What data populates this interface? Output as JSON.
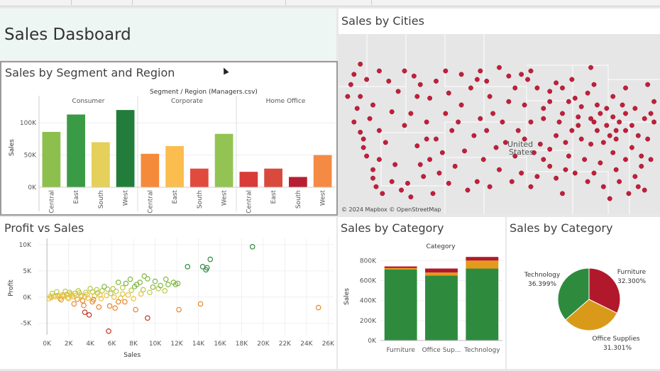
{
  "dashboard": {
    "title": "Sales Dasboard"
  },
  "segment_panel": {
    "title": "Sales by Segment and Region",
    "header": "Segment / Region (Managers.csv)"
  },
  "map_panel": {
    "title": "Sales by Cities",
    "credit": "© 2024 Mapbox © OpenStreetMap",
    "label_united": "United",
    "label_states": "States"
  },
  "scatter_panel": {
    "title": "Profit vs Sales"
  },
  "category_panel": {
    "title": "Sales  by Category",
    "legend_title": "Category"
  },
  "pie_panel": {
    "title": "Sales by Category"
  },
  "colors": {
    "red": "#b2182b",
    "orange": "#f08a3e",
    "yellow": "#e6d05a",
    "green": "#2e8b3e",
    "map_dot": "#c41e3a"
  },
  "chart_data": [
    {
      "type": "bar",
      "title": "Sales by Segment and Region",
      "ylabel": "Sales",
      "ylim": [
        0,
        130000
      ],
      "yticks": [
        {
          "v": 0,
          "label": "0K"
        },
        {
          "v": 50000,
          "label": "50K"
        },
        {
          "v": 100000,
          "label": "100K"
        }
      ],
      "groups": [
        {
          "name": "Consumer",
          "categories": [
            "Central",
            "East",
            "South",
            "West"
          ],
          "values": [
            86000,
            113000,
            70000,
            120000
          ],
          "colors": [
            "#8cbf4e",
            "#3a9a45",
            "#e4d05a",
            "#237d3a"
          ]
        },
        {
          "name": "Corporate",
          "categories": [
            "Central",
            "East",
            "South",
            "West"
          ],
          "values": [
            52000,
            64000,
            29000,
            83000
          ],
          "colors": [
            "#f58a3a",
            "#fbbd4d",
            "#e04b3e",
            "#93c453"
          ]
        },
        {
          "name": "Home Office",
          "categories": [
            "Central",
            "East",
            "South",
            "West"
          ],
          "values": [
            24000,
            29000,
            16000,
            50000
          ],
          "colors": [
            "#d93b38",
            "#d94a3c",
            "#b71e31",
            "#f58a45"
          ]
        }
      ]
    },
    {
      "type": "scatter",
      "title": "Profit vs Sales",
      "xlabel": "Sales",
      "ylabel": "Profit",
      "xlim": [
        -800,
        26500
      ],
      "ylim": [
        -7200,
        11200
      ],
      "xticks": [
        {
          "v": 0,
          "label": "0K"
        },
        {
          "v": 2000,
          "label": "2K"
        },
        {
          "v": 4000,
          "label": "4K"
        },
        {
          "v": 6000,
          "label": "6K"
        },
        {
          "v": 8000,
          "label": "8K"
        },
        {
          "v": 10000,
          "label": "10K"
        },
        {
          "v": 12000,
          "label": "12K"
        },
        {
          "v": 14000,
          "label": "14K"
        },
        {
          "v": 16000,
          "label": "16K"
        },
        {
          "v": 18000,
          "label": "18K"
        },
        {
          "v": 20000,
          "label": "20K"
        },
        {
          "v": 22000,
          "label": "22K"
        },
        {
          "v": 24000,
          "label": "24K"
        },
        {
          "v": 26000,
          "label": "26K"
        }
      ],
      "yticks": [
        {
          "v": -5000,
          "label": "-5K"
        },
        {
          "v": 0,
          "label": "0K"
        },
        {
          "v": 5000,
          "label": "5K"
        },
        {
          "v": 10000,
          "label": "10K"
        }
      ],
      "points": [
        [
          19000,
          9600
        ],
        [
          15100,
          7200
        ],
        [
          13000,
          5800
        ],
        [
          14400,
          5800
        ],
        [
          14700,
          5200
        ],
        [
          14800,
          5600
        ],
        [
          9000,
          4000
        ],
        [
          9300,
          3500
        ],
        [
          10000,
          3000
        ],
        [
          11700,
          2800
        ],
        [
          12100,
          2600
        ],
        [
          11200,
          2400
        ],
        [
          11900,
          2400
        ],
        [
          6600,
          2800
        ],
        [
          7700,
          3400
        ],
        [
          7300,
          2600
        ],
        [
          8300,
          2400
        ],
        [
          8600,
          2800
        ],
        [
          9800,
          1900
        ],
        [
          10300,
          1600
        ],
        [
          10900,
          1200
        ],
        [
          8900,
          1400
        ],
        [
          8100,
          2000
        ],
        [
          7000,
          1800
        ],
        [
          6100,
          1600
        ],
        [
          5600,
          1500
        ],
        [
          5100,
          1200
        ],
        [
          4600,
          1400
        ],
        [
          4200,
          1000
        ],
        [
          3600,
          900
        ],
        [
          3000,
          800
        ],
        [
          2600,
          700
        ],
        [
          2200,
          600
        ],
        [
          1800,
          500
        ],
        [
          1400,
          400
        ],
        [
          1000,
          300
        ],
        [
          600,
          200
        ],
        [
          300,
          100
        ],
        [
          400,
          -100
        ],
        [
          800,
          100
        ],
        [
          1200,
          -200
        ],
        [
          1600,
          200
        ],
        [
          2000,
          -300
        ],
        [
          2400,
          100
        ],
        [
          2800,
          -400
        ],
        [
          3200,
          300
        ],
        [
          3800,
          -200
        ],
        [
          4400,
          200
        ],
        [
          5000,
          -300
        ],
        [
          5500,
          300
        ],
        [
          6200,
          0
        ],
        [
          6800,
          -200
        ],
        [
          7500,
          400
        ],
        [
          8000,
          -300
        ],
        [
          2500,
          -1300
        ],
        [
          3400,
          -1600
        ],
        [
          4200,
          -900
        ],
        [
          5800,
          -1700
        ],
        [
          7200,
          -900
        ],
        [
          8200,
          -2400
        ],
        [
          3500,
          -2900
        ],
        [
          3900,
          -3400
        ],
        [
          6300,
          -2100
        ],
        [
          4800,
          -1900
        ],
        [
          9300,
          -4000
        ],
        [
          12200,
          -2400
        ],
        [
          14200,
          -1300
        ],
        [
          5700,
          -6500
        ],
        [
          25100,
          -2000
        ],
        [
          500,
          700
        ],
        [
          900,
          1000
        ],
        [
          1300,
          -500
        ],
        [
          1700,
          1100
        ],
        [
          2100,
          900
        ],
        [
          2900,
          1200
        ],
        [
          3300,
          -700
        ],
        [
          4000,
          1600
        ],
        [
          4700,
          800
        ],
        [
          5300,
          2000
        ],
        [
          6400,
          1100
        ],
        [
          7000,
          600
        ],
        [
          7800,
          1300
        ],
        [
          8700,
          600
        ],
        [
          9500,
          900
        ],
        [
          10500,
          2200
        ],
        [
          11000,
          3400
        ],
        [
          1500,
          300
        ],
        [
          2300,
          400
        ],
        [
          3100,
          200
        ],
        [
          3700,
          500
        ],
        [
          4300,
          -500
        ],
        [
          5900,
          700
        ],
        [
          6600,
          -900
        ],
        [
          200,
          -300
        ],
        [
          1100,
          100
        ],
        [
          1900,
          -100
        ],
        [
          2700,
          300
        ],
        [
          3500,
          100
        ],
        [
          4900,
          400
        ]
      ]
    },
    {
      "type": "bar",
      "title": "Sales  by Category",
      "ylabel": "Sales",
      "legend_title": "Category",
      "ylim": [
        0,
        880000
      ],
      "yticks": [
        {
          "v": 0,
          "label": "0K"
        },
        {
          "v": 200000,
          "label": "200K"
        },
        {
          "v": 400000,
          "label": "400K"
        },
        {
          "v": 600000,
          "label": "600K"
        },
        {
          "v": 800000,
          "label": "800K"
        }
      ],
      "categories": [
        "Furniture",
        "Office Sup...",
        "Technology"
      ],
      "stacks": [
        [
          {
            "value": 710000,
            "color": "#2e8b3e"
          },
          {
            "value": 15000,
            "color": "#e59a1c"
          },
          {
            "value": 16000,
            "color": "#b2182b"
          }
        ],
        [
          {
            "value": 650000,
            "color": "#2e8b3e"
          },
          {
            "value": 30000,
            "color": "#e59a1c"
          },
          {
            "value": 40000,
            "color": "#b2182b"
          }
        ],
        [
          {
            "value": 720000,
            "color": "#2e8b3e"
          },
          {
            "value": 80000,
            "color": "#e59a1c"
          },
          {
            "value": 36000,
            "color": "#b2182b"
          }
        ]
      ]
    },
    {
      "type": "pie",
      "title": "Sales by Category",
      "slices": [
        {
          "label": "Furniture",
          "pct_label": "32.300%",
          "value": 32.3,
          "color": "#b2182b"
        },
        {
          "label": "Office Supplies",
          "pct_label": "31.301%",
          "value": 31.301,
          "color": "#d99a1a"
        },
        {
          "label": "Technology",
          "pct_label": "36.399%",
          "value": 36.399,
          "color": "#2e8b3e"
        }
      ]
    }
  ],
  "map_markers": [
    [
      0.12,
      0.2
    ],
    [
      0.2,
      0.2
    ],
    [
      0.23,
      0.23
    ],
    [
      0.06,
      0.16
    ],
    [
      0.03,
      0.28
    ],
    [
      0.06,
      0.35
    ],
    [
      0.04,
      0.5
    ],
    [
      0.06,
      0.56
    ],
    [
      0.07,
      0.6
    ],
    [
      0.07,
      0.65
    ],
    [
      0.08,
      0.7
    ],
    [
      0.1,
      0.78
    ],
    [
      0.1,
      0.83
    ],
    [
      0.11,
      0.88
    ],
    [
      0.13,
      0.92
    ],
    [
      0.16,
      0.85
    ],
    [
      0.19,
      0.9
    ],
    [
      0.21,
      0.86
    ],
    [
      0.26,
      0.82
    ],
    [
      0.28,
      0.72
    ],
    [
      0.3,
      0.6
    ],
    [
      0.27,
      0.5
    ],
    [
      0.28,
      0.36
    ],
    [
      0.25,
      0.28
    ],
    [
      0.3,
      0.26
    ],
    [
      0.34,
      0.33
    ],
    [
      0.38,
      0.22
    ],
    [
      0.44,
      0.2
    ],
    [
      0.5,
      0.18
    ],
    [
      0.53,
      0.23
    ],
    [
      0.57,
      0.22
    ],
    [
      0.6,
      0.2
    ],
    [
      0.62,
      0.3
    ],
    [
      0.66,
      0.32
    ],
    [
      0.68,
      0.27
    ],
    [
      0.72,
      0.38
    ],
    [
      0.74,
      0.36
    ],
    [
      0.78,
      0.33
    ],
    [
      0.76,
      0.41
    ],
    [
      0.8,
      0.5
    ],
    [
      0.82,
      0.45
    ],
    [
      0.84,
      0.42
    ],
    [
      0.86,
      0.47
    ],
    [
      0.88,
      0.5
    ],
    [
      0.9,
      0.55
    ],
    [
      0.92,
      0.52
    ],
    [
      0.94,
      0.58
    ],
    [
      0.97,
      0.6
    ],
    [
      0.95,
      0.7
    ],
    [
      0.9,
      0.72
    ],
    [
      0.86,
      0.68
    ],
    [
      0.82,
      0.74
    ],
    [
      0.79,
      0.63
    ],
    [
      0.76,
      0.6
    ],
    [
      0.73,
      0.55
    ],
    [
      0.71,
      0.62
    ],
    [
      0.68,
      0.58
    ],
    [
      0.66,
      0.66
    ],
    [
      0.63,
      0.63
    ],
    [
      0.6,
      0.5
    ],
    [
      0.56,
      0.55
    ],
    [
      0.55,
      0.7
    ],
    [
      0.57,
      0.8
    ],
    [
      0.5,
      0.78
    ],
    [
      0.47,
      0.88
    ],
    [
      0.43,
      0.85
    ],
    [
      0.4,
      0.9
    ],
    [
      0.36,
      0.76
    ],
    [
      0.39,
      0.67
    ],
    [
      0.42,
      0.58
    ],
    [
      0.44,
      0.48
    ],
    [
      0.46,
      0.55
    ],
    [
      0.52,
      0.62
    ],
    [
      0.62,
      0.82
    ],
    [
      0.68,
      0.83
    ],
    [
      0.74,
      0.8
    ],
    [
      0.78,
      0.85
    ],
    [
      0.83,
      0.88
    ],
    [
      0.88,
      0.85
    ],
    [
      0.93,
      0.82
    ],
    [
      0.96,
      0.9
    ],
    [
      0.91,
      0.92
    ],
    [
      0.85,
      0.95
    ],
    [
      0.7,
      0.92
    ],
    [
      0.6,
      0.88
    ],
    [
      0.99,
      0.5
    ],
    [
      0.98,
      0.45
    ],
    [
      0.85,
      0.58
    ],
    [
      0.83,
      0.62
    ],
    [
      0.87,
      0.6
    ],
    [
      0.81,
      0.55
    ],
    [
      0.79,
      0.48
    ],
    [
      0.75,
      0.47
    ],
    [
      0.7,
      0.45
    ],
    [
      0.69,
      0.5
    ],
    [
      0.64,
      0.48
    ],
    [
      0.58,
      0.4
    ],
    [
      0.53,
      0.38
    ],
    [
      0.47,
      0.35
    ],
    [
      0.41,
      0.3
    ],
    [
      0.33,
      0.45
    ],
    [
      0.35,
      0.55
    ],
    [
      0.2,
      0.52
    ],
    [
      0.16,
      0.44
    ],
    [
      0.14,
      0.62
    ],
    [
      0.12,
      0.72
    ],
    [
      0.17,
      0.75
    ],
    [
      0.24,
      0.64
    ],
    [
      0.32,
      0.68
    ],
    [
      0.51,
      0.5
    ],
    [
      0.49,
      0.65
    ],
    [
      0.64,
      0.72
    ],
    [
      0.72,
      0.7
    ],
    [
      0.77,
      0.72
    ],
    [
      0.92,
      0.65
    ],
    [
      0.89,
      0.4
    ],
    [
      0.93,
      0.42
    ],
    [
      0.96,
      0.48
    ],
    [
      0.8,
      0.28
    ],
    [
      0.7,
      0.3
    ],
    [
      0.64,
      0.42
    ],
    [
      0.58,
      0.6
    ],
    [
      0.45,
      0.72
    ],
    [
      0.38,
      0.4
    ],
    [
      0.27,
      0.6
    ],
    [
      0.22,
      0.45
    ],
    [
      0.18,
      0.32
    ],
    [
      0.1,
      0.4
    ],
    [
      0.09,
      0.48
    ],
    [
      0.05,
      0.42
    ],
    [
      0.04,
      0.22
    ],
    [
      0.15,
      0.26
    ],
    [
      0.43,
      0.25
    ],
    [
      0.55,
      0.3
    ],
    [
      0.66,
      0.38
    ],
    [
      0.75,
      0.52
    ],
    [
      0.84,
      0.52
    ],
    [
      0.87,
      0.55
    ],
    [
      0.9,
      0.45
    ],
    [
      0.81,
      0.4
    ],
    [
      0.86,
      0.35
    ],
    [
      0.71,
      0.78
    ],
    [
      0.54,
      0.85
    ],
    [
      0.34,
      0.86
    ],
    [
      0.29,
      0.92
    ],
    [
      0.22,
      0.94
    ],
    [
      0.95,
      0.76
    ],
    [
      0.98,
      0.72
    ],
    [
      0.94,
      0.88
    ],
    [
      0.87,
      0.78
    ],
    [
      0.8,
      0.8
    ],
    [
      0.66,
      0.76
    ],
    [
      0.61,
      0.68
    ],
    [
      0.48,
      0.45
    ],
    [
      0.37,
      0.5
    ],
    [
      0.31,
      0.8
    ],
    [
      0.25,
      0.75
    ],
    [
      0.12,
      0.55
    ],
    [
      0.02,
      0.35
    ],
    [
      0.08,
      0.25
    ],
    [
      0.24,
      0.35
    ],
    [
      0.33,
      0.2
    ],
    [
      0.46,
      0.26
    ],
    [
      0.59,
      0.25
    ],
    [
      0.73,
      0.25
    ],
    [
      0.79,
      0.18
    ],
    [
      0.9,
      0.3
    ],
    [
      0.99,
      0.38
    ],
    [
      0.97,
      0.28
    ]
  ]
}
